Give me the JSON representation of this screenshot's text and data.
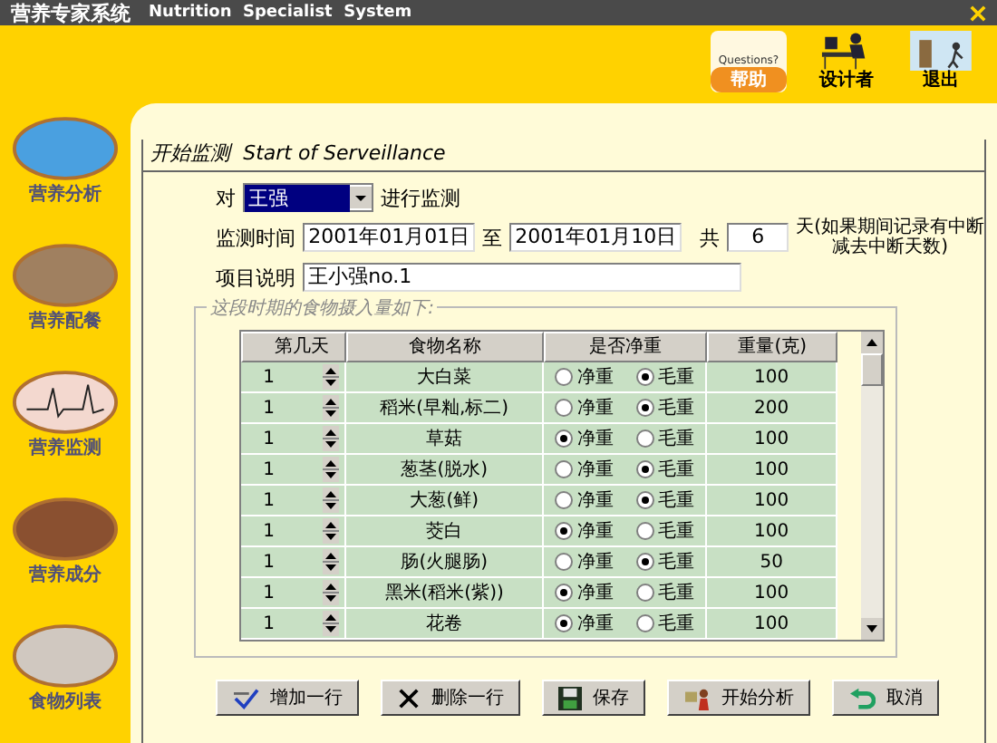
{
  "window": {
    "title": "营养专家系统",
    "subtitle": "Nutrition  Specialist  System"
  },
  "toolbar": [
    {
      "label": "帮助",
      "kind": "help",
      "caption": "Questions?"
    },
    {
      "label": "设计者",
      "kind": "designer"
    },
    {
      "label": "退出",
      "kind": "exit"
    }
  ],
  "sidebar": {
    "items": [
      {
        "label": "营养分析",
        "kind": "analysis"
      },
      {
        "label": "营养配餐",
        "kind": "meal"
      },
      {
        "label": "营养监测",
        "kind": "monitor"
      },
      {
        "label": "营养成分",
        "kind": "components"
      },
      {
        "label": "食物列表",
        "kind": "foods"
      }
    ]
  },
  "panel": {
    "title": "开始监测  Start of Serveillance"
  },
  "form": {
    "prefix": "对",
    "person": "王强",
    "suffix": "进行监测",
    "period_label": "监测时间",
    "start": "2001年01月01日",
    "to": "至",
    "end": "2001年01月10日",
    "total_label": "共",
    "days": "6",
    "note_lines": [
      "天(如果期间记录有中断",
      "减去中断天数)"
    ],
    "description_label": "项目说明",
    "description": "王小强no.1"
  },
  "intake": {
    "legend": "这段时期的食物摄入量如下:",
    "columns": [
      "第几天",
      "食物名称",
      "是否净重",
      "重量(克)"
    ],
    "rows": [
      {
        "day": "1",
        "food": "大白菜",
        "net_label": "净重",
        "gross_label": "毛重",
        "net_weight": false,
        "weight": "100"
      },
      {
        "day": "1",
        "food": "稻米(早籼,标二)",
        "net_label": "净重",
        "gross_label": "毛重",
        "net_weight": false,
        "weight": "200"
      },
      {
        "day": "1",
        "food": "草菇",
        "net_label": "净重",
        "gross_label": "毛重",
        "net_weight": true,
        "weight": "100"
      },
      {
        "day": "1",
        "food": "葱茎(脱水)",
        "net_label": "净重",
        "gross_label": "毛重",
        "net_weight": false,
        "weight": "100"
      },
      {
        "day": "1",
        "food": "大葱(鲜)",
        "net_label": "净重",
        "gross_label": "毛重",
        "net_weight": false,
        "weight": "100"
      },
      {
        "day": "1",
        "food": "茭白",
        "net_label": "净重",
        "gross_label": "毛重",
        "net_weight": true,
        "weight": "100"
      },
      {
        "day": "1",
        "food": "肠(火腿肠)",
        "net_label": "净重",
        "gross_label": "毛重",
        "net_weight": false,
        "weight": "50"
      },
      {
        "day": "1",
        "food": "黑米(稻米(紫))",
        "net_label": "净重",
        "gross_label": "毛重",
        "net_weight": true,
        "weight": "100"
      },
      {
        "day": "1",
        "food": "花卷",
        "net_label": "净重",
        "gross_label": "毛重",
        "net_weight": true,
        "weight": "100"
      }
    ]
  },
  "buttons": [
    {
      "label": "增加一行",
      "kind": "add"
    },
    {
      "label": "删除一行",
      "kind": "delete"
    },
    {
      "label": "保存",
      "kind": "save"
    },
    {
      "label": "开始分析",
      "kind": "analyze"
    },
    {
      "label": "取消",
      "kind": "cancel"
    }
  ]
}
